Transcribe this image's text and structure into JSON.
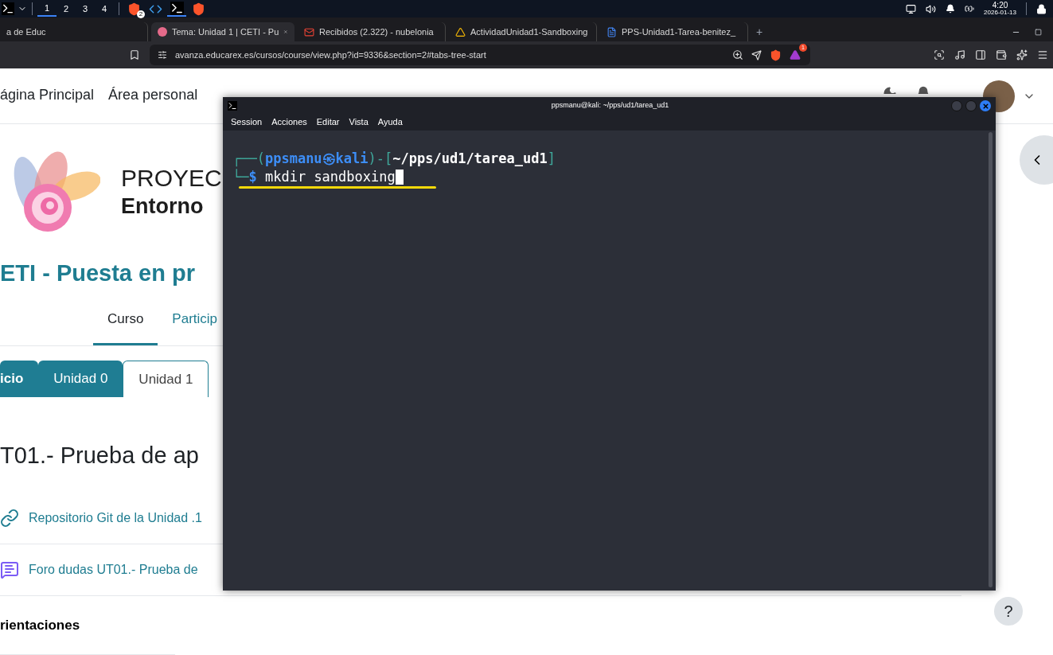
{
  "taskbar": {
    "workspaces": [
      {
        "label": "1",
        "selected": true
      },
      {
        "label": "2",
        "selected": false
      },
      {
        "label": "3",
        "selected": false
      },
      {
        "label": "4",
        "selected": false
      }
    ],
    "apps": [
      {
        "kind": "brave",
        "badge": "2",
        "active": false
      },
      {
        "kind": "code",
        "active": false
      },
      {
        "kind": "terminal",
        "active": true
      },
      {
        "kind": "brave",
        "active": false
      }
    ],
    "time": "4:20",
    "date": "2026-01-13"
  },
  "browser": {
    "tabs": [
      {
        "title": "a de Educ",
        "kind": "none",
        "selected": false
      },
      {
        "title": "Tema: Unidad 1 | CETI - Pu",
        "kind": "moodle",
        "selected": true
      },
      {
        "title": "Recibidos (2.322) - nubelonia",
        "kind": "mail",
        "selected": false
      },
      {
        "title": "ActividadUnidad1-Sandboxing",
        "kind": "drive",
        "selected": false
      },
      {
        "title": "PPS-Unidad1-Tarea-benitez_",
        "kind": "docs",
        "selected": false
      }
    ],
    "new_tab": "+",
    "address": "avanza.educarex.es/cursos/course/view.php?id=9336&section=2#tabs-tree-start",
    "rewards_badge": "1"
  },
  "page": {
    "nav": [
      "ágina Principal",
      "Área personal"
    ],
    "site_title": "PROYEC",
    "site_subtitle": "Entorno",
    "course_title": "ETI - Puesta en pr",
    "course_tabs": [
      {
        "label": "Curso",
        "selected": true
      },
      {
        "label": "Particip",
        "selected": false
      }
    ],
    "unit_tabs": [
      {
        "label": "icio",
        "selected": false
      },
      {
        "label": "Unidad 0",
        "selected": false
      },
      {
        "label": "Unidad 1",
        "selected": true
      }
    ],
    "section_title": "T01.- Prueba de ap",
    "activities": [
      {
        "kind": "url",
        "title": "Repositorio Git de la Unidad .1"
      },
      {
        "kind": "forum",
        "title": "Foro dudas UT01.- Prueba de"
      }
    ],
    "subsection": "rientaciones",
    "help": "?"
  },
  "terminal": {
    "title": "ppsmanu@kali: ~/pps/ud1/tarea_ud1",
    "menu": [
      "Session",
      "Acciones",
      "Editar",
      "Vista",
      "Ayuda"
    ],
    "lines": [
      [
        {
          "text": "┌──(",
          "kind": "frame"
        },
        {
          "text": "ppsmanu㉿kali",
          "kind": "user"
        },
        {
          "text": ")-[",
          "kind": "frame"
        },
        {
          "text": "~/pps/ud1/tarea_ud1",
          "kind": "path"
        },
        {
          "text": "]",
          "kind": "frame"
        }
      ],
      [
        {
          "text": "└─",
          "kind": "frame"
        },
        {
          "text": "$",
          "kind": "user"
        },
        {
          "text": " mkdir sandboxing",
          "kind": "command"
        }
      ]
    ]
  }
}
